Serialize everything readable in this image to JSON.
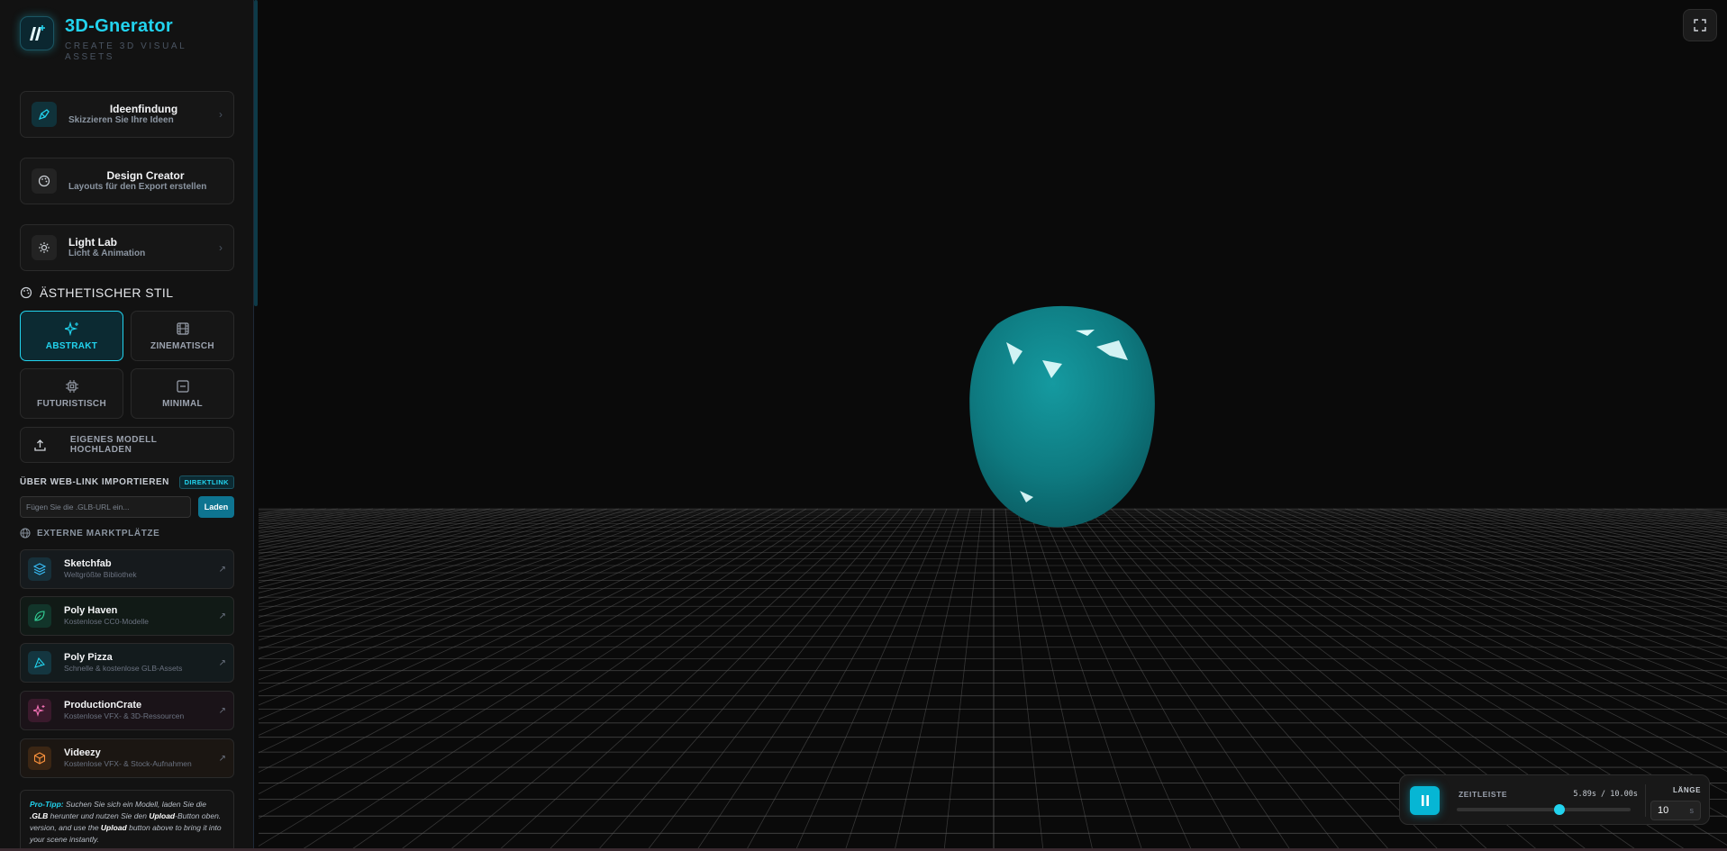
{
  "brand": {
    "title": "3D-Gnerator",
    "subtitle": "CREATE 3D VISUAL ASSETS"
  },
  "nav": [
    {
      "title": "Ideenfindung",
      "subtitle": "Skizzieren Sie Ihre Ideen",
      "icon": "pen-icon"
    },
    {
      "title": "Design Creator",
      "subtitle": "Layouts für den Export erstellen",
      "icon": "palette-icon"
    },
    {
      "title": "Light Lab",
      "subtitle": "Licht & Animation",
      "icon": "sun-icon"
    }
  ],
  "style_section": {
    "title": "ÄSTHETISCHER STIL"
  },
  "styles": [
    {
      "label": "ABSTRAKT",
      "active": true
    },
    {
      "label": "ZINEMATISCH",
      "active": false
    },
    {
      "label": "FUTURISTISCH",
      "active": false
    },
    {
      "label": "MINIMAL",
      "active": false
    }
  ],
  "upload": {
    "label": "EIGENES MODELL HOCHLADEN"
  },
  "import": {
    "title": "ÜBER WEB-LINK IMPORTIEREN",
    "badge": "DIREKTLINK",
    "placeholder": "Fügen Sie die .GLB-URL ein...",
    "load_label": "Laden"
  },
  "external": {
    "title": "EXTERNE MARKTPLÄTZE"
  },
  "markets": [
    {
      "title": "Sketchfab",
      "subtitle": "Weltgrößte Bibliothek",
      "color": "#38bdf8"
    },
    {
      "title": "Poly Haven",
      "subtitle": "Kostenlose CC0-Modelle",
      "color": "#34d399"
    },
    {
      "title": "Poly Pizza",
      "subtitle": "Schnelle & kostenlose GLB-Assets",
      "color": "#22d3ee"
    },
    {
      "title": "ProductionCrate",
      "subtitle": "Kostenlose VFX- & 3D-Ressourcen",
      "color": "#f472b6"
    },
    {
      "title": "Videezy",
      "subtitle": "Kostenlose VFX- & Stock-Aufnahmen",
      "color": "#fb923c"
    }
  ],
  "protip": {
    "label": "Pro-Tipp:",
    "text1": " Suchen Sie sich ein Modell, laden Sie die ",
    "glb": ".GLB",
    "text2": " herunter und nutzen Sie den ",
    "upload1": "Upload",
    "text3": "-Button oben. version, and use the ",
    "upload2": "Upload",
    "text4": " button above to bring it into your scene instantly."
  },
  "viewport": {
    "model_color": "#0e7a80",
    "grid_color": "#5a5a5a"
  },
  "timeline": {
    "label": "ZEITLEISTE",
    "time": "5.89s / 10.00s",
    "progress": 0.589,
    "length_label": "LÄNGE",
    "length_value": "10",
    "length_unit": "s"
  }
}
